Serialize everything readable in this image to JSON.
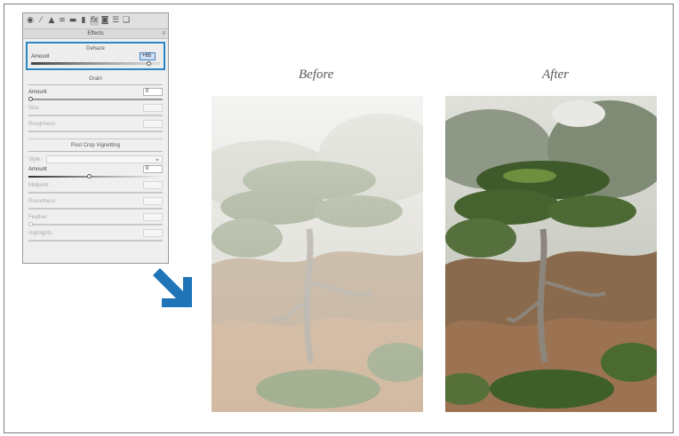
{
  "toolbar": {
    "icons": [
      "basic-icon",
      "tone-curve-icon",
      "detail-icon",
      "hsl-icon",
      "split-toning-icon",
      "lens-icon",
      "fx-icon",
      "camera-calibration-icon",
      "presets-icon",
      "snapshots-icon"
    ]
  },
  "panel": {
    "tab_title": "Effects",
    "dehaze": {
      "title": "Dehaze",
      "amount_label": "Amount",
      "amount_value": "+65"
    },
    "grain": {
      "title": "Grain",
      "amount_label": "Amount",
      "amount_value": "0",
      "size_label": "Size",
      "roughness_label": "Roughness"
    },
    "vignetting": {
      "title": "Post Crop Vignetting",
      "style_label": "Style:",
      "amount_label": "Amount",
      "amount_value": "0",
      "midpoint_label": "Midpoint",
      "roundness_label": "Roundness",
      "feather_label": "Feather",
      "highlights_label": "Highlights"
    }
  },
  "captions": {
    "before": "Before",
    "after": "After"
  },
  "colors": {
    "arrow": "#1f73b7",
    "highlight_border": "#2a86c6"
  }
}
